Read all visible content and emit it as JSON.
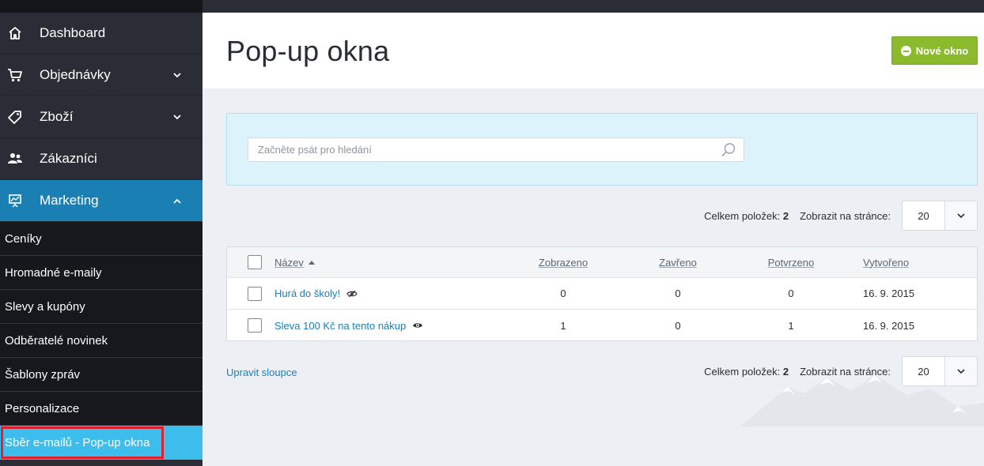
{
  "sidebar": {
    "items": [
      {
        "label": "Dashboard"
      },
      {
        "label": "Objednávky"
      },
      {
        "label": "Zboží"
      },
      {
        "label": "Zákazníci"
      },
      {
        "label": "Marketing"
      }
    ],
    "submenu": [
      {
        "label": "Ceníky"
      },
      {
        "label": "Hromadné e-maily"
      },
      {
        "label": "Slevy a kupóny"
      },
      {
        "label": "Odběratelé novinek"
      },
      {
        "label": "Šablony zpráv"
      },
      {
        "label": "Personalizace"
      },
      {
        "label": "Sběr e-mailů - Pop-up okna"
      }
    ]
  },
  "header": {
    "title": "Pop-up okna",
    "new_button": "Nové okno"
  },
  "search": {
    "placeholder": "Začněte psát pro hledání"
  },
  "pager": {
    "total_label": "Celkem položek:",
    "total_value": "2",
    "per_page_label": "Zobrazit na stránce:",
    "per_page_value": "20"
  },
  "table": {
    "columns": {
      "name": "Název",
      "shown": "Zobrazeno",
      "closed": "Zavřeno",
      "confirmed": "Potvrzeno",
      "created": "Vytvořeno"
    },
    "rows": [
      {
        "name": "Hurá do školy!",
        "shown": "0",
        "closed": "0",
        "confirmed": "0",
        "created": "16. 9. 2015",
        "visible": false
      },
      {
        "name": "Sleva 100 Kč na tento nákup",
        "shown": "1",
        "closed": "0",
        "confirmed": "1",
        "created": "16. 9. 2015",
        "visible": true
      }
    ]
  },
  "footer": {
    "edit_columns": "Upravit sloupce"
  },
  "colors": {
    "accent": "#1a80b3",
    "highlight": "#3dbdeb",
    "button": "#8cba2d",
    "annotation": "#e3202f"
  }
}
